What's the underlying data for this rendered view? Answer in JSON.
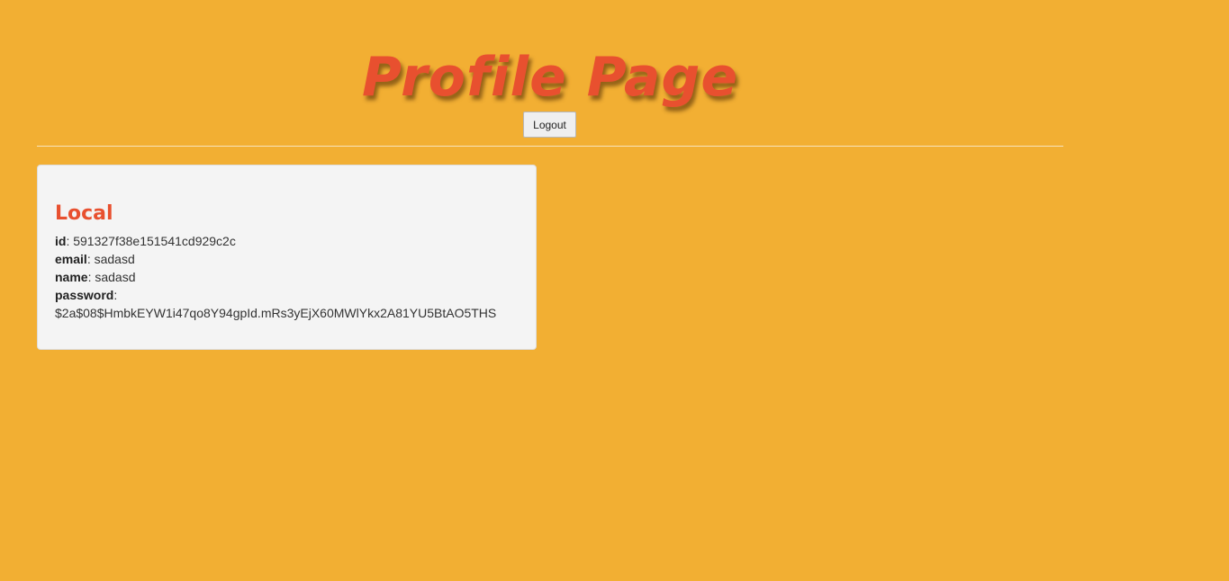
{
  "header": {
    "title": "Profile Page",
    "logout_label": "Logout"
  },
  "local_card": {
    "title": "Local",
    "fields": [
      {
        "label": "id",
        "value": "591327f38e151541cd929c2c"
      },
      {
        "label": "email",
        "value": "sadasd"
      },
      {
        "label": "name",
        "value": "sadasd"
      },
      {
        "label": "password",
        "value": "$2a$08$HmbkEYW1i47qo8Y94gpId.mRs3yEjX60MWlYkx2A81YU5BtAO5THS"
      }
    ]
  },
  "colors": {
    "background": "#f2af33",
    "accent": "#e8502f",
    "card_background": "#f4f4f4"
  }
}
